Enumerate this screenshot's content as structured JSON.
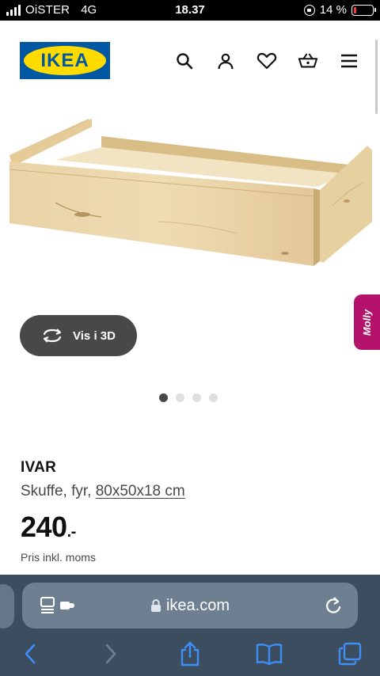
{
  "status_bar": {
    "carrier": "OiSTER",
    "network": "4G",
    "time": "18.37",
    "battery_text": "14 %",
    "battery_color": "#ff3b30",
    "battery_level": 0.14
  },
  "header": {
    "logo_text": "IKEA",
    "icons": [
      "search-icon",
      "user-icon",
      "heart-icon",
      "basket-icon",
      "menu-icon"
    ]
  },
  "product_image": {
    "view3d_label": "Vis i 3D",
    "molly_label": "Molly",
    "carousel_count": 4,
    "carousel_active": 1
  },
  "product": {
    "name": "IVAR",
    "desc_prefix": "Skuffe, fyr, ",
    "dimensions": "80x50x18 cm",
    "price": "240",
    "price_suffix": ".-",
    "vat_note": "Pris inkl. moms"
  },
  "browser": {
    "domain": "ikea.com",
    "accent": "#3d4d60"
  }
}
